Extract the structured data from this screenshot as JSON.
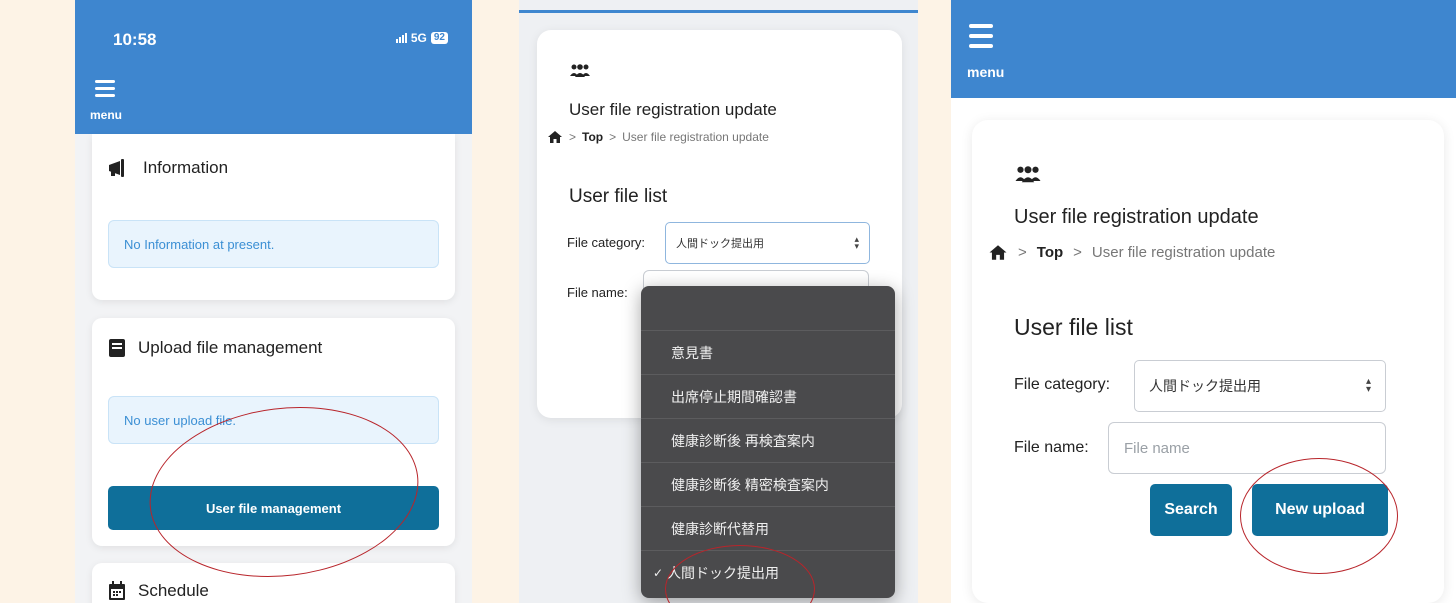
{
  "phone_status": {
    "time": "10:58",
    "network": "5G",
    "battery": "92"
  },
  "menu_label": "menu",
  "dashboard": {
    "information": {
      "title": "Information",
      "empty_text": "No Information at present."
    },
    "upload": {
      "title": "Upload file management",
      "empty_text": "No user upload file.",
      "button": "User file management"
    },
    "schedule": {
      "title": "Schedule"
    }
  },
  "file_page": {
    "title": "User file registration update",
    "breadcrumb": {
      "top": "Top",
      "current": "User file registration update"
    },
    "list_title": "User file list",
    "category_label": "File category:",
    "category_value": "人間ドック提出用",
    "name_label": "File name:",
    "name_placeholder": "File name",
    "search_button": "Search",
    "upload_button": "New upload"
  },
  "dropdown_options": [
    {
      "label": "意見書",
      "selected": false
    },
    {
      "label": "出席停止期間確認書",
      "selected": false
    },
    {
      "label": "健康診断後 再検査案内",
      "selected": false
    },
    {
      "label": "健康診断後 精密検査案内",
      "selected": false
    },
    {
      "label": "健康診断代替用",
      "selected": false
    },
    {
      "label": "人間ドック提出用",
      "selected": true
    }
  ],
  "colors": {
    "header": "#3e86cf",
    "button": "#0f6f9a",
    "annotation": "#b8252b"
  }
}
